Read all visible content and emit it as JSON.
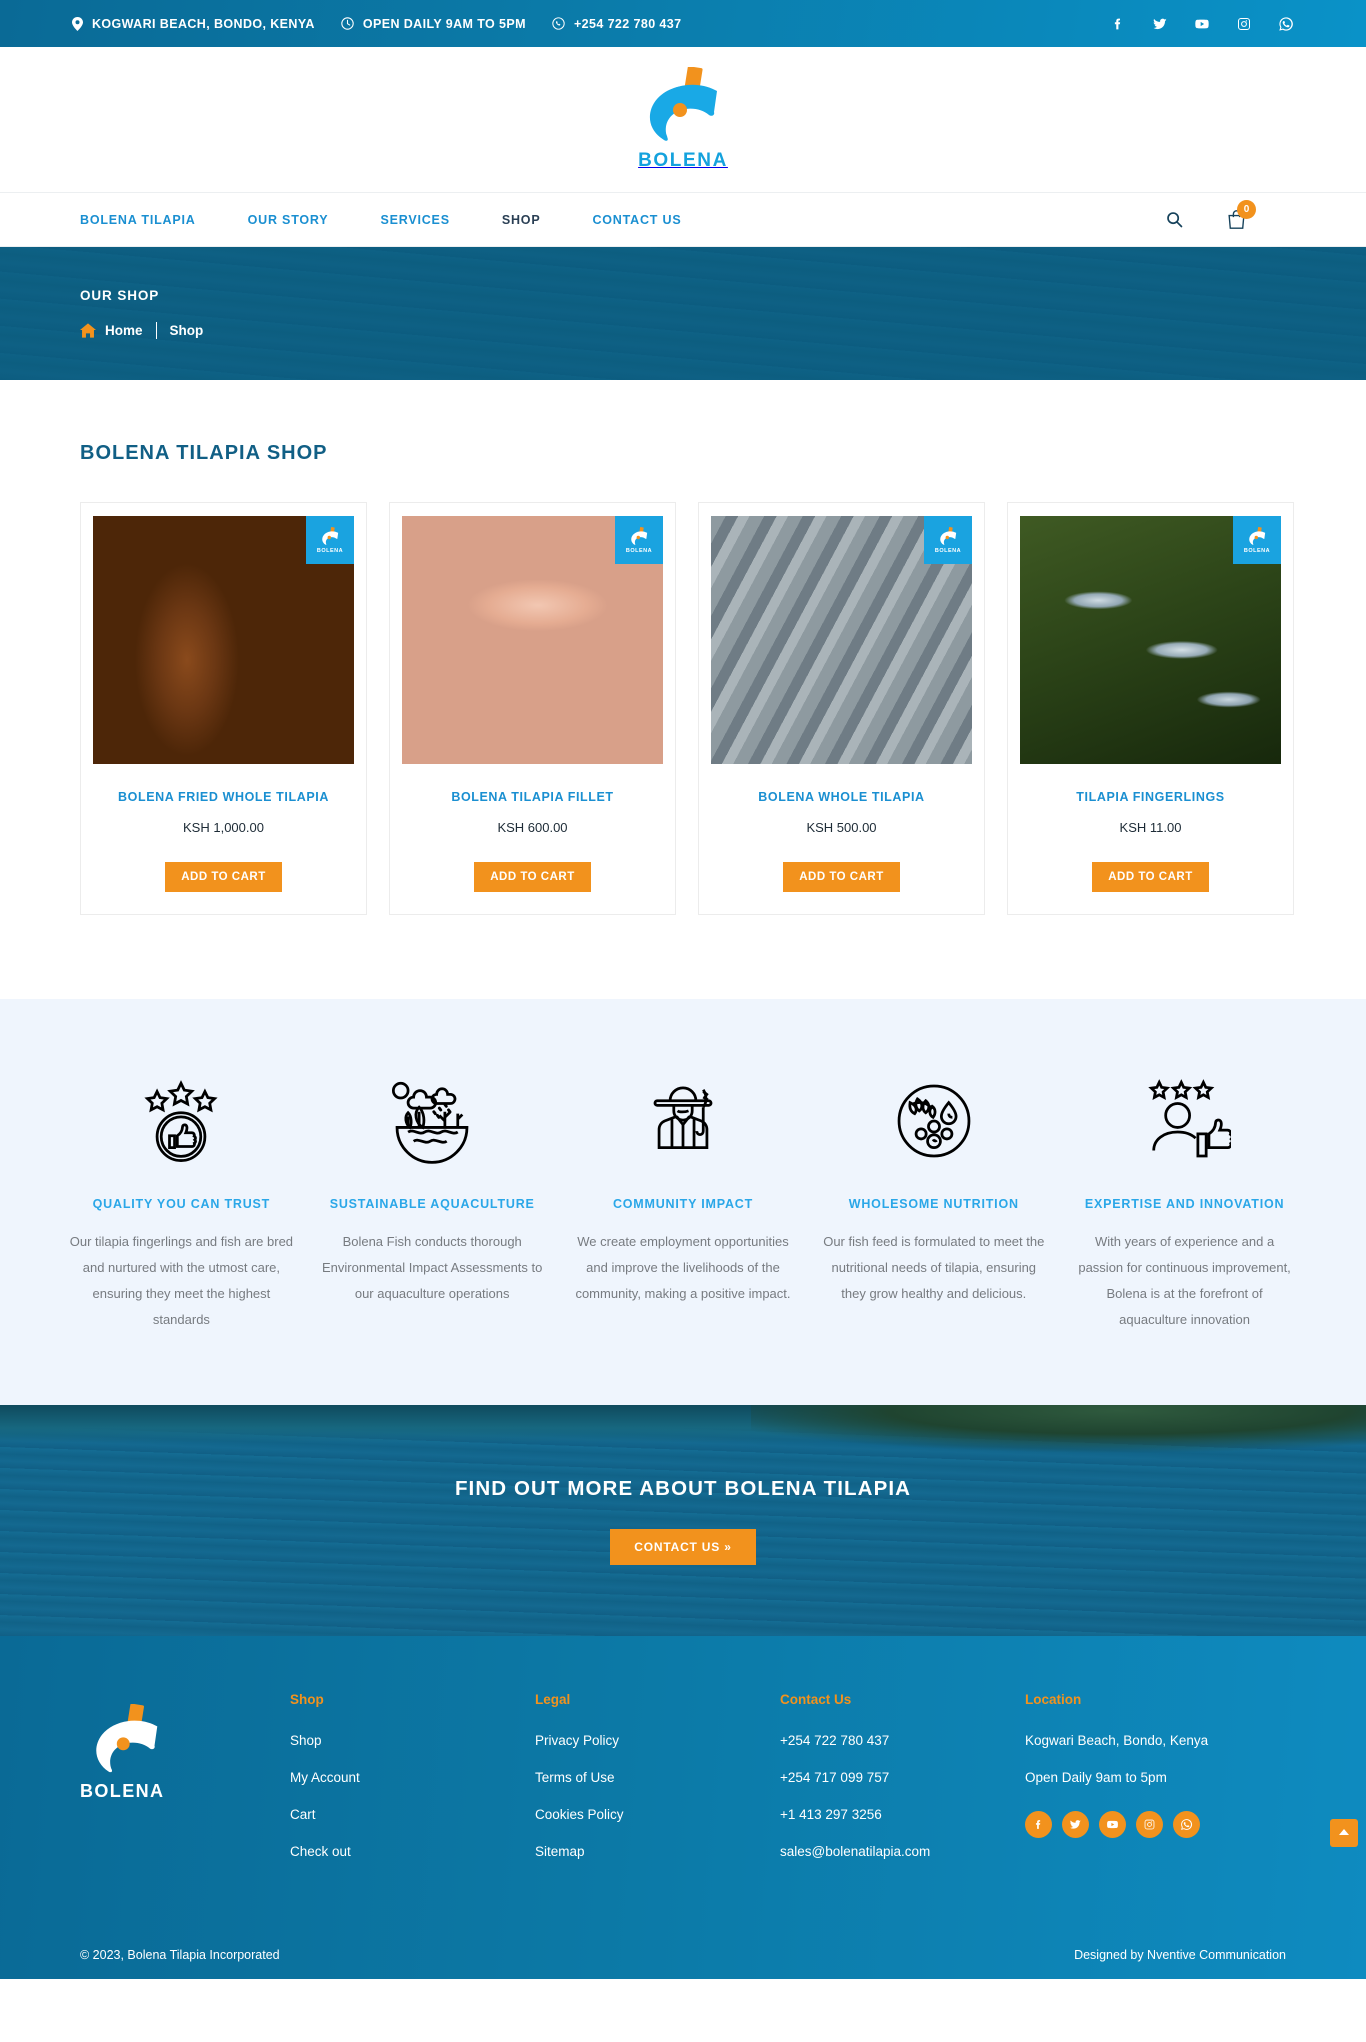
{
  "topbar": {
    "address": "KOGWARI BEACH, BONDO, KENYA",
    "hours": "OPEN DAILY 9AM TO 5PM",
    "phone": "+254 722 780 437",
    "socials": [
      "facebook-icon",
      "twitter-icon",
      "youtube-icon",
      "instagram-icon",
      "whatsapp-icon"
    ]
  },
  "brand": {
    "name": "BOLENA",
    "accent": "#14a2dd",
    "orange": "#f2921d"
  },
  "nav": {
    "items": [
      {
        "label": "BOLENA TILAPIA",
        "active": false
      },
      {
        "label": "OUR STORY",
        "active": false
      },
      {
        "label": "SERVICES",
        "active": false
      },
      {
        "label": "SHOP",
        "active": true
      },
      {
        "label": "CONTACT US",
        "active": false
      }
    ],
    "search_icon": "search-icon",
    "cart_icon": "cart-icon",
    "cart_count": "0"
  },
  "hero": {
    "title": "OUR SHOP",
    "crumb_home": "Home",
    "crumb_current": "Shop"
  },
  "shop": {
    "heading": "BOLENA TILAPIA SHOP",
    "add_to_cart": "ADD TO CART",
    "badge_word": "BOLENA",
    "products": [
      {
        "name": "BOLENA FRIED WHOLE TILAPIA",
        "price": "KSH 1,000.00",
        "img": "img-fried"
      },
      {
        "name": "BOLENA TILAPIA FILLET",
        "price": "KSH 600.00",
        "img": "img-fillet"
      },
      {
        "name": "BOLENA WHOLE TILAPIA",
        "price": "KSH 500.00",
        "img": "img-whole"
      },
      {
        "name": "TILAPIA FINGERLINGS",
        "price": "KSH 11.00",
        "img": "img-finger"
      }
    ]
  },
  "features": [
    {
      "icon": "thumbs-up-stars-icon",
      "title": "QUALITY YOU CAN TRUST",
      "desc": "Our tilapia fingerlings and fish are bred and nurtured with the utmost care, ensuring they meet the highest standards"
    },
    {
      "icon": "eco-earth-icon",
      "title": "SUSTAINABLE AQUACULTURE",
      "desc": "Bolena Fish conducts thorough Environmental Impact Assessments to our aquaculture operations"
    },
    {
      "icon": "farmer-icon",
      "title": "COMMUNITY IMPACT",
      "desc": "We create employment opportunities and improve the livelihoods of the community, making a positive impact."
    },
    {
      "icon": "nutrition-circle-icon",
      "title": "WHOLESOME NUTRITION",
      "desc": "Our fish feed is formulated to meet the nutritional needs of tilapia, ensuring they grow healthy and delicious."
    },
    {
      "icon": "expert-stars-icon",
      "title": "EXPERTISE AND INNOVATION",
      "desc": "With years of experience and a passion for continuous improvement, Bolena is at the forefront of aquaculture innovation"
    }
  ],
  "cta": {
    "title": "FIND OUT MORE ABOUT BOLENA TILAPIA",
    "button": "CONTACT US »"
  },
  "footer": {
    "columns": [
      {
        "head": "Shop",
        "links": [
          "Shop",
          "My Account",
          "Cart",
          "Check out"
        ]
      },
      {
        "head": "Legal",
        "links": [
          "Privacy Policy",
          "Terms of Use",
          "Cookies Policy",
          "Sitemap"
        ]
      },
      {
        "head": "Contact Us",
        "links": [
          "+254 722 780 437",
          "+254 717 099 757",
          "+1 413 297 3256",
          "sales@bolenatilapia.com"
        ]
      },
      {
        "head": "Location",
        "links": [
          "Kogwari Beach, Bondo, Kenya",
          "Open Daily 9am to 5pm"
        ]
      }
    ],
    "socials": [
      "facebook-icon",
      "twitter-icon",
      "youtube-icon",
      "instagram-icon",
      "whatsapp-icon"
    ],
    "copyright": "© 2023, Bolena Tilapia Incorporated",
    "designer": "Designed by Nventive Communication"
  }
}
